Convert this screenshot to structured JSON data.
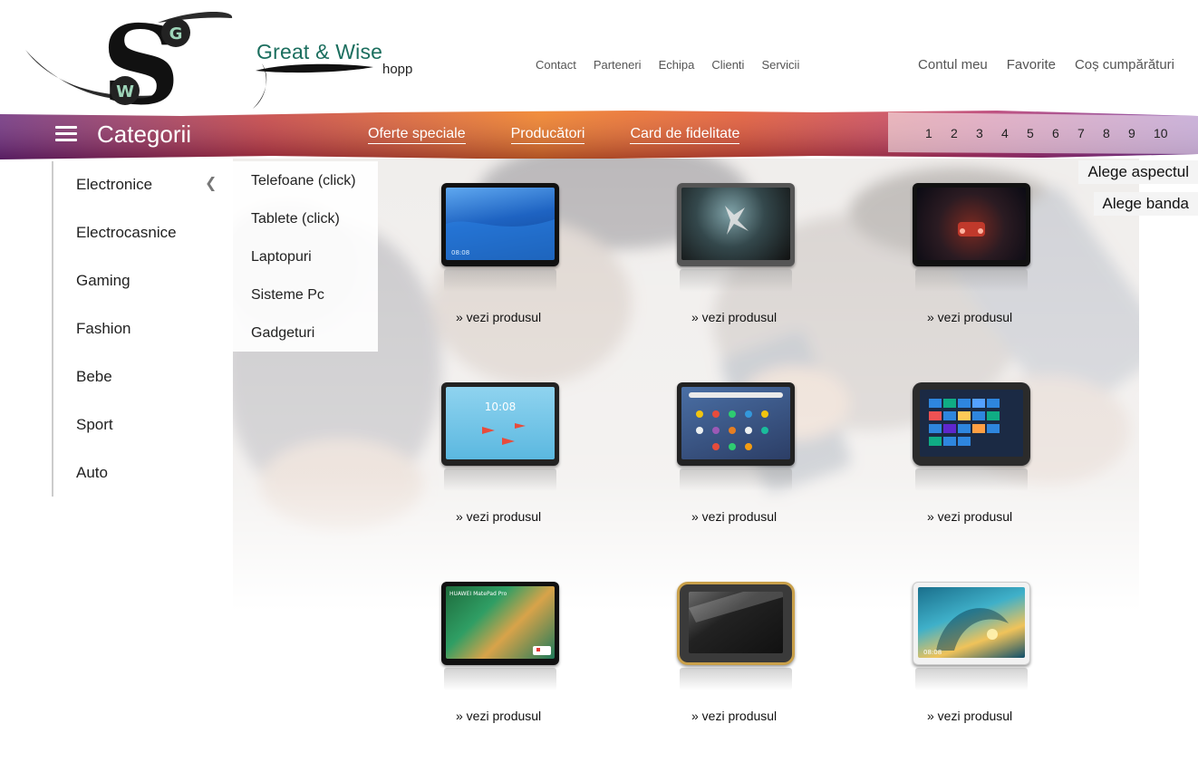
{
  "brand": {
    "name": "Great & Wise",
    "sub": "hopp",
    "logo_letters": [
      "S",
      "G",
      "W"
    ]
  },
  "top_nav": [
    "Contact",
    "Parteneri",
    "Echipa",
    "Clienti",
    "Servicii"
  ],
  "account_nav": [
    "Contul meu",
    "Favorite",
    "Coș cumpărături"
  ],
  "banner": {
    "title": "Categorii",
    "links": [
      "Oferte speciale",
      "Producători",
      "Card de fidelitate"
    ],
    "pages": [
      "1",
      "2",
      "3",
      "4",
      "5",
      "6",
      "7",
      "8",
      "9",
      "10"
    ]
  },
  "side_buttons": {
    "aspect": "Alege aspectul",
    "banda": "Alege banda"
  },
  "sidebar": {
    "items": [
      "Electronice",
      "Electrocasnice",
      "Gaming",
      "Fashion",
      "Bebe",
      "Sport",
      "Auto"
    ],
    "open_indicator": "❮"
  },
  "submenu": [
    "Telefoane (click)",
    "Tablete (click)",
    "Laptopuri",
    "Sisteme Pc",
    "Gadgeturi"
  ],
  "products": {
    "link_label": "» vezi produsul",
    "items": [
      {
        "screen_text": "08:08",
        "theme": "blue-wave"
      },
      {
        "screen_text": "",
        "theme": "dark-diver"
      },
      {
        "screen_text": "",
        "theme": "dark-car"
      },
      {
        "screen_text": "10:08",
        "theme": "sky-planes"
      },
      {
        "screen_text": "",
        "theme": "home-screen"
      },
      {
        "screen_text": "",
        "theme": "windows-tiles"
      },
      {
        "screen_text": "HUAWEI MatePad Pro",
        "theme": "green-swirl"
      },
      {
        "screen_text": "",
        "theme": "rugged"
      },
      {
        "screen_text": "08:08",
        "theme": "ocean-wave"
      }
    ]
  },
  "colors": {
    "brand_green": "#1b6e5e",
    "banner_purple": "#6b2a7a",
    "banner_orange": "#e8531f"
  }
}
